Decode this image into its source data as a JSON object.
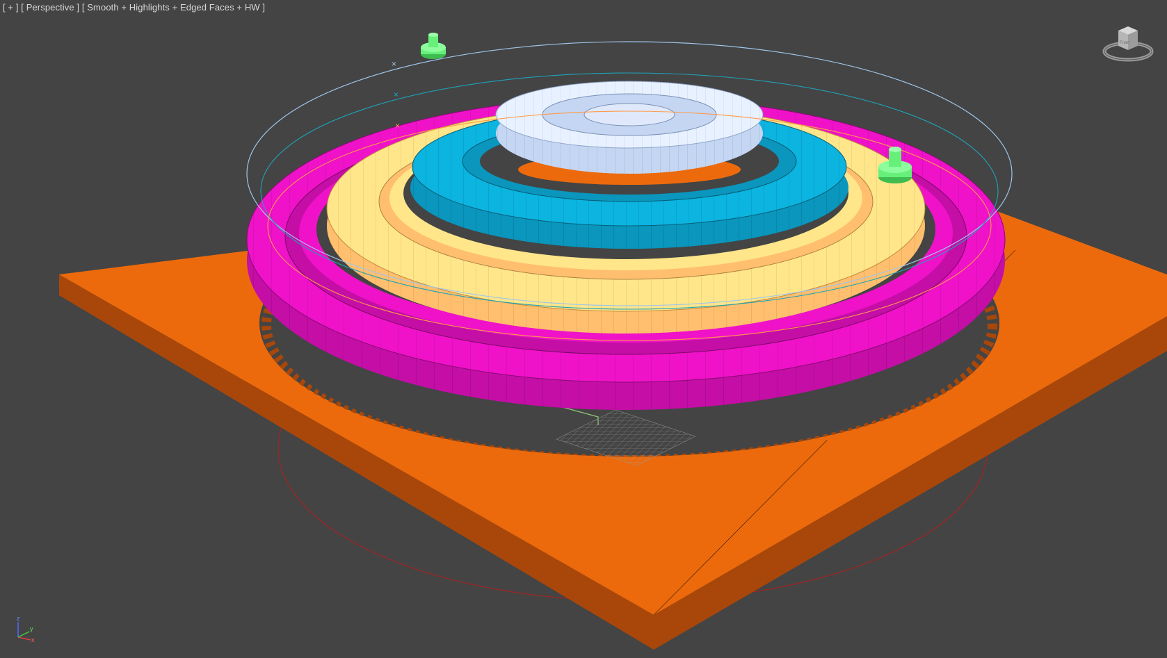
{
  "viewport": {
    "label_parts": [
      "[ + ]",
      "[ Perspective ]",
      "[ Smooth + Highlights + Edged Faces + HW ]"
    ]
  },
  "viewcube": {
    "icon": "viewcube-icon",
    "face_label": "Front"
  },
  "axis_tripod": {
    "x": "x",
    "y": "y",
    "z": "z"
  },
  "scene_colors": {
    "background": "#444444",
    "plane_top": "#ec6a0c",
    "plane_side": "#a9470a",
    "magenta_top": "#ef12c8",
    "magenta_side": "#c40ea6",
    "yellow_top": "#ffe68a",
    "yellow_side": "#ffbf6e",
    "cyan_top": "#0cb4e0",
    "cyan_side": "#0a96bd",
    "white_top": "#e8f1ff",
    "white_side": "#c4d6f2",
    "gizmo_green": "#66f07a"
  }
}
